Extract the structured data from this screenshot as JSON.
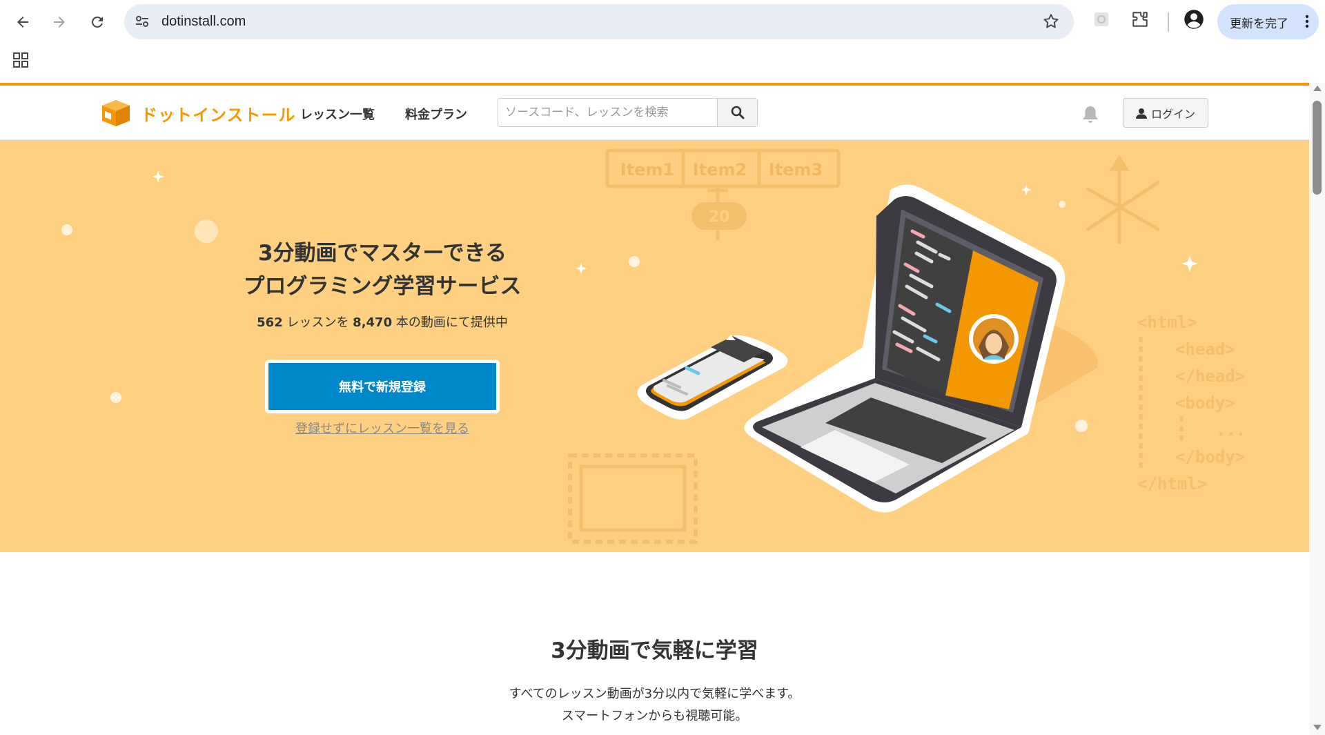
{
  "browser": {
    "url": "dotinstall.com",
    "update_label": "更新を完了"
  },
  "header": {
    "logo_text": "ドットインストール",
    "nav": [
      "レッスン一覧",
      "料金プラン"
    ],
    "search_placeholder": "ソースコード、レッスンを検索",
    "login_label": "ログイン"
  },
  "hero": {
    "title_line1": "3分動画でマスターできる",
    "title_line2": "プログラミング学習サービス",
    "lessons_count": "562",
    "lessons_text": " レッスンを ",
    "videos_count": "8,470",
    "videos_text": " 本の動画にて提供中",
    "signup_label": "無料で新規登録",
    "browse_label": "登録せずにレッスン一覧を見る",
    "art": {
      "tabs": [
        "Item1",
        "Item2",
        "Item3"
      ],
      "badge": "20",
      "code_lines": [
        "<html>",
        "<head>",
        "</head>",
        "<body>",
        "...",
        "</body>",
        "</html>"
      ]
    }
  },
  "section": {
    "title": "3分動画で気軽に学習",
    "desc_line1": "すべてのレッスン動画が3分以内で気軽に学べます。",
    "desc_line2": "スマートフォンからも視聴可能。"
  },
  "colors": {
    "brand_orange": "#f39800",
    "hero_bg": "#ffd082",
    "signup_blue": "#0087c9"
  }
}
